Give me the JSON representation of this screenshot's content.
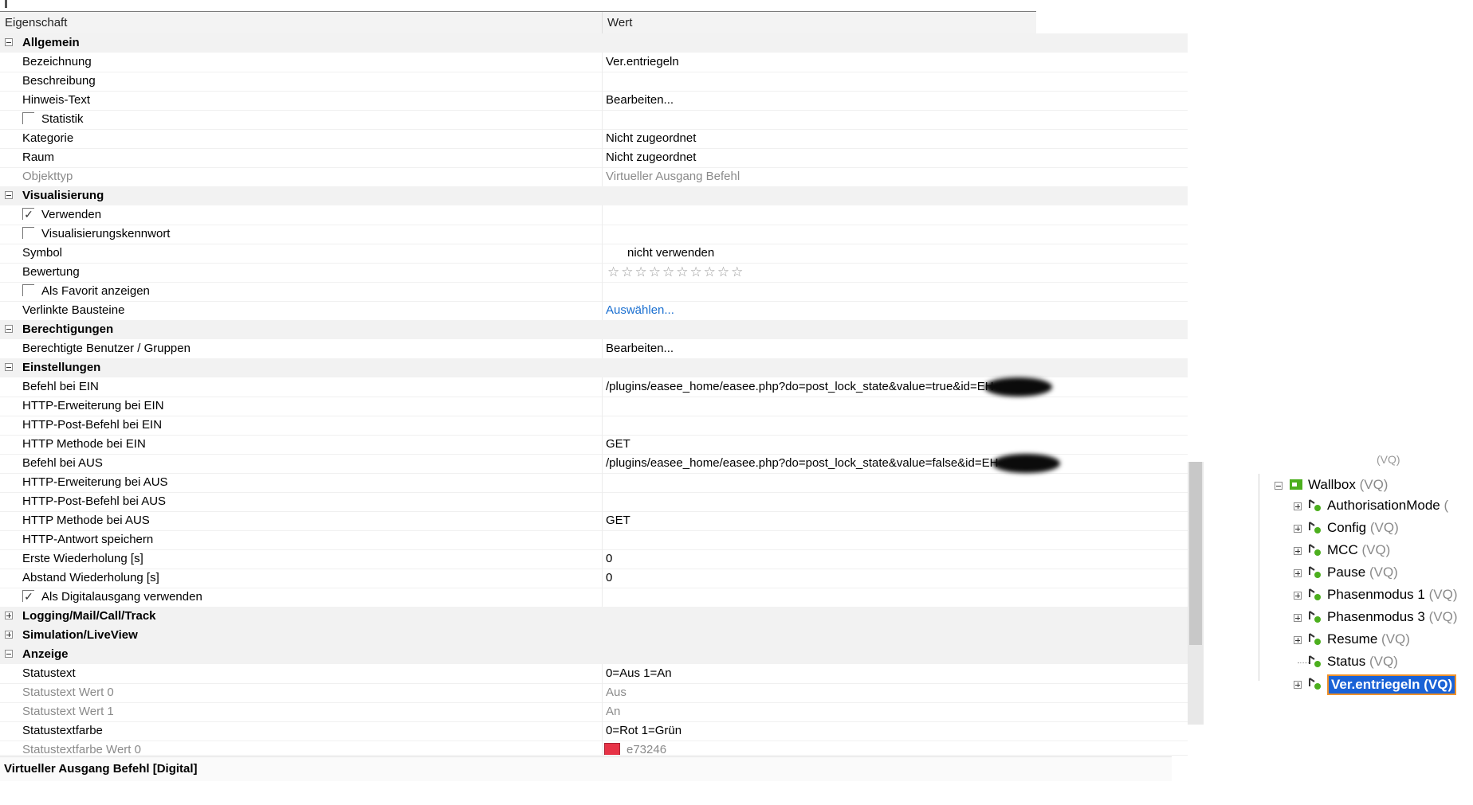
{
  "grid": {
    "header": {
      "property": "Eigenschaft",
      "value": "Wert"
    },
    "sections": {
      "allgemein": "Allgemein",
      "visualisierung": "Visualisierung",
      "berechtigungen": "Berechtigungen",
      "einstellungen": "Einstellungen",
      "logging": "Logging/Mail/Call/Track",
      "simulation": "Simulation/LiveView",
      "anzeige": "Anzeige"
    },
    "rows": {
      "bezeichnung": {
        "name": "Bezeichnung",
        "value": "Ver.entriegeln"
      },
      "beschreibung": {
        "name": "Beschreibung",
        "value": ""
      },
      "hinweis": {
        "name": "Hinweis-Text",
        "value": "Bearbeiten..."
      },
      "statistik": {
        "name": "Statistik",
        "checked": false
      },
      "kategorie": {
        "name": "Kategorie",
        "value": "Nicht zugeordnet"
      },
      "raum": {
        "name": "Raum",
        "value": "Nicht zugeordnet"
      },
      "objekttyp": {
        "name": "Objekttyp",
        "value": "Virtueller Ausgang Befehl"
      },
      "verwenden": {
        "name": "Verwenden",
        "checked": true
      },
      "vis_kennwort": {
        "name": "Visualisierungskennwort",
        "checked": false
      },
      "symbol": {
        "name": "Symbol",
        "value": "nicht verwenden"
      },
      "bewertung": {
        "name": "Bewertung",
        "stars": "☆☆☆☆☆☆☆☆☆☆",
        "rating": 0
      },
      "favorit": {
        "name": "Als Favorit anzeigen",
        "checked": false
      },
      "bausteine": {
        "name": "Verlinkte Bausteine",
        "value": "Auswählen..."
      },
      "berechtigte": {
        "name": "Berechtigte Benutzer / Gruppen",
        "value": "Bearbeiten..."
      },
      "befehl_ein": {
        "name": "Befehl bei EIN",
        "value": "/plugins/easee_home/easee.php?do=post_lock_state&value=true&id=EH"
      },
      "http_erw_ein": {
        "name": "HTTP-Erweiterung bei EIN",
        "value": ""
      },
      "http_post_ein": {
        "name": "HTTP-Post-Befehl bei EIN",
        "value": ""
      },
      "http_meth_ein": {
        "name": "HTTP Methode bei EIN",
        "value": "GET"
      },
      "befehl_aus": {
        "name": "Befehl bei AUS",
        "value": "/plugins/easee_home/easee.php?do=post_lock_state&value=false&id=EH"
      },
      "http_erw_aus": {
        "name": "HTTP-Erweiterung bei AUS",
        "value": ""
      },
      "http_post_aus": {
        "name": "HTTP-Post-Befehl bei AUS",
        "value": ""
      },
      "http_meth_aus": {
        "name": "HTTP Methode bei AUS",
        "value": "GET"
      },
      "http_antwort": {
        "name": "HTTP-Antwort speichern",
        "value": ""
      },
      "erste_wdh": {
        "name": "Erste Wiederholung [s]",
        "value": "0"
      },
      "abstand_wdh": {
        "name": "Abstand Wiederholung [s]",
        "value": "0"
      },
      "digitalausgang": {
        "name": "Als Digitalausgang verwenden",
        "checked": true
      },
      "statustext": {
        "name": "Statustext",
        "value": "0=Aus 1=An"
      },
      "statustext0": {
        "name": "Statustext Wert 0",
        "value": "Aus"
      },
      "statustext1": {
        "name": "Statustext Wert 1",
        "value": "An"
      },
      "statusfarbe": {
        "name": "Statustextfarbe",
        "value": "0=Rot 1=Grün"
      },
      "statusfarbe0": {
        "name": "Statustextfarbe Wert 0",
        "value": "e73246",
        "color": "#e73246"
      }
    },
    "status_bar": "Virtueller Ausgang Befehl [Digital]"
  },
  "tree": {
    "top_fragment": "(VQ)",
    "root": {
      "label": "Wallbox",
      "suffix": "(VQ)"
    },
    "children": [
      {
        "label": "AuthorisationMode",
        "suffix": "("
      },
      {
        "label": "Config",
        "suffix": "(VQ)"
      },
      {
        "label": "MCC",
        "suffix": "(VQ)"
      },
      {
        "label": "Pause",
        "suffix": "(VQ)"
      },
      {
        "label": "Phasenmodus 1",
        "suffix": "(VQ)"
      },
      {
        "label": "Phasenmodus 3",
        "suffix": "(VQ)"
      },
      {
        "label": "Resume",
        "suffix": "(VQ)"
      },
      {
        "label": "Status",
        "suffix": "(VQ)"
      },
      {
        "label": "Ver.entriegeln",
        "suffix": "(VQ)"
      }
    ],
    "selected": "Ver.entriegeln (VQ)"
  },
  "colors": {
    "selection": "#1a62d6",
    "selection_border": "#f0922a",
    "link": "#1a6fd0",
    "icon_green": "#4caf1e"
  }
}
